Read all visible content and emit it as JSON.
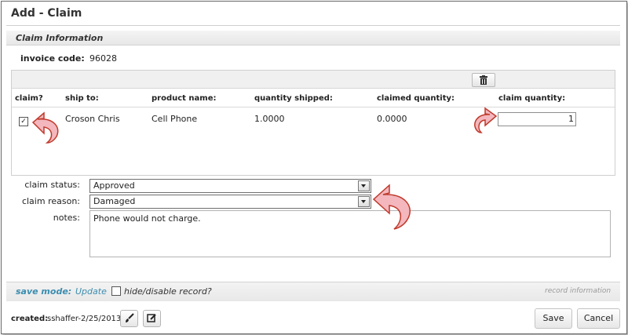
{
  "dialog": {
    "title": "Add - Claim"
  },
  "section": {
    "title": "Claim Information"
  },
  "invoice": {
    "label": "invoice code:",
    "value": "96028"
  },
  "grid": {
    "columns": [
      "claim?",
      "ship to:",
      "product name:",
      "quantity shipped:",
      "claimed quantity:",
      "claim quantity:"
    ],
    "rows": [
      {
        "claim": "✓",
        "ship_to": "Croson Chris",
        "product_name": "Cell Phone",
        "quantity_shipped": "1.0000",
        "claimed_quantity": "0.0000",
        "claim_quantity": "1"
      }
    ]
  },
  "form": {
    "claim_status_label": "claim status:",
    "claim_status_value": "Approved",
    "claim_reason_label": "claim reason:",
    "claim_reason_value": "Damaged",
    "notes_label": "notes:",
    "notes_value": "Phone would not charge."
  },
  "footer": {
    "save_mode_label": "save mode:",
    "save_mode_value": "Update",
    "hide_label": "hide/disable record?",
    "record_info": "record information",
    "created_label": "created:",
    "created_value": "sshaffer-2/25/2013",
    "save_label": "Save",
    "cancel_label": "Cancel"
  },
  "colors": {
    "accent": "#3b8db0",
    "annotation_arrow": "#d94a5a"
  }
}
